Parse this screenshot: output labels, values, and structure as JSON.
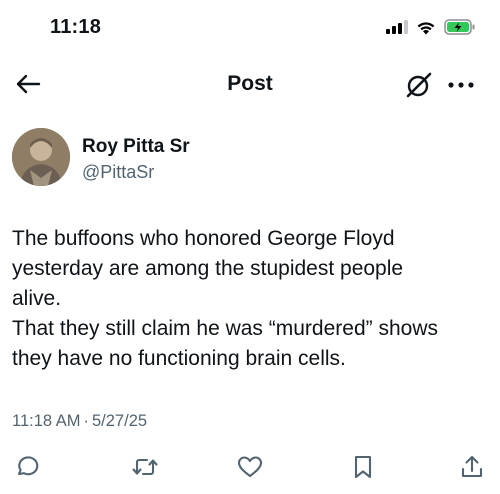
{
  "status_bar": {
    "time": "11:18",
    "icons": [
      "signal-icon",
      "wifi-icon",
      "battery-charging-icon"
    ],
    "battery_color": "#34c759"
  },
  "nav": {
    "title": "Post",
    "icons": [
      "back-arrow-icon",
      "grok-icon",
      "more-icon"
    ]
  },
  "post": {
    "author": {
      "name": "Roy Pitta Sr",
      "handle": "@PittaSr"
    },
    "text_lines": [
      "The buffoons who honored George Floyd",
      "yesterday are among the stupidest people",
      "alive.",
      "That they still claim he was “murdered” shows",
      "they have no functioning brain cells."
    ],
    "time": "11:18 AM",
    "separator": "·",
    "date": "5/27/25"
  },
  "actions": [
    "reply-icon",
    "repost-icon",
    "like-icon",
    "bookmark-icon",
    "share-icon"
  ],
  "colors": {
    "text": "#0f1419",
    "secondary": "#536471",
    "icon": "#536471"
  }
}
